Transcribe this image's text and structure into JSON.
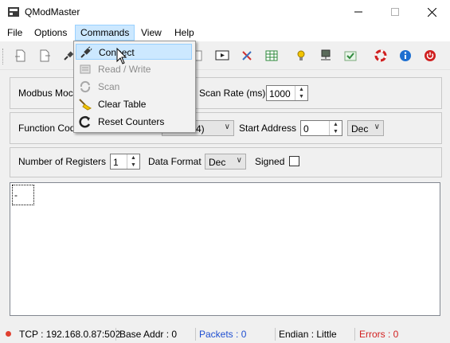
{
  "window": {
    "title": "QModMaster"
  },
  "menubar": {
    "items": [
      "File",
      "Options",
      "Commands",
      "View",
      "Help"
    ]
  },
  "commands_menu": {
    "items": [
      {
        "label": "Connect",
        "icon": "connect-plug-icon",
        "enabled": true,
        "hover": true
      },
      {
        "label": "Read / Write",
        "icon": "read-write-icon",
        "enabled": false
      },
      {
        "label": "Scan",
        "icon": "scan-icon",
        "enabled": false
      },
      {
        "label": "Clear Table",
        "icon": "broom-icon",
        "enabled": true
      },
      {
        "label": "Reset Counters",
        "icon": "reset-icon",
        "enabled": true
      }
    ]
  },
  "settings": {
    "modbus_mode_label": "Modbus Moc",
    "scan_rate_label": "Scan Rate (ms)",
    "scan_rate_value": "1000",
    "function_code_label": "Function Cod",
    "function_code_value_fragment": "4)",
    "start_address_label": "Start Address",
    "start_address_value": "0",
    "start_address_format": "Dec",
    "num_registers_label": "Number of Registers",
    "num_registers_value": "1",
    "data_format_label": "Data Format",
    "data_format_value": "Dec",
    "signed_label": "Signed"
  },
  "output": {
    "text": "-"
  },
  "statusbar": {
    "connection": "TCP : 192.168.0.87:502",
    "base_addr": "Base Addr : 0",
    "packets": "Packets : 0",
    "endian": "Endian : Little",
    "errors": "Errors : 0"
  },
  "colors": {
    "accent_blue": "#1f4fd1",
    "error_red": "#d22020",
    "menu_highlight": "#cce8ff"
  }
}
